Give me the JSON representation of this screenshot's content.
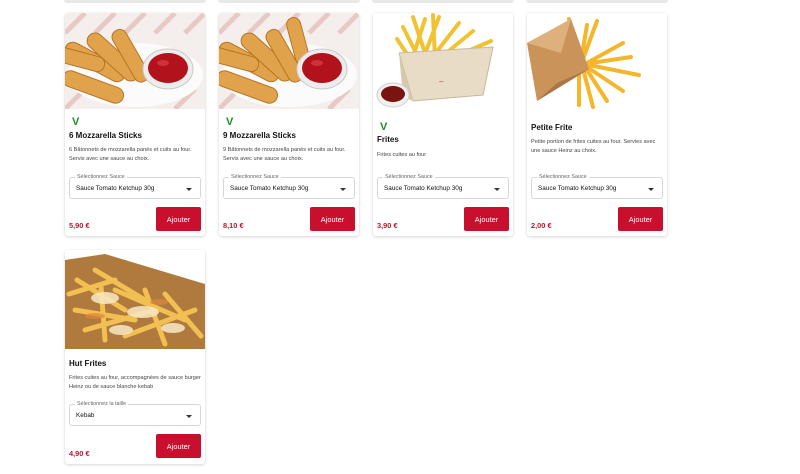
{
  "products": [
    {
      "veg_mark": "V",
      "name": "6 Mozzarella Sticks",
      "description": "6 Bâtonnets de mozzarella panés et cuits au four. Servis avec une sauce au choix.",
      "select_label": "Sélectionnez Sauce",
      "select_value": "Sauce Tomato Ketchup 30g",
      "price": "5,90 €",
      "button_label": "Ajouter"
    },
    {
      "veg_mark": "V",
      "name": "9 Mozzarella Sticks",
      "description": "9 Bâtonnets de mozzarella panés et cuits au four. Servis avec une sauce au choix.",
      "select_label": "Sélectionnez Sauce",
      "select_value": "Sauce Tomato Ketchup 30g",
      "price": "8,10 €",
      "button_label": "Ajouter"
    },
    {
      "veg_mark": "V",
      "name": "Frites",
      "description": "Frites cuites au four",
      "select_label": "Sélectionnez Sauce",
      "select_value": "Sauce Tomato Ketchup 30g",
      "price": "3,90 €",
      "button_label": "Ajouter"
    },
    {
      "name": "Petite Frite",
      "description": "Petite portion de frites cuites au four. Servies avec une sauce Heinz au choix.",
      "select_label": "Sélectionnez Sauce",
      "select_value": "Sauce Tomato Ketchup 30g",
      "price": "2,00 €",
      "button_label": "Ajouter"
    },
    {
      "name": "Hut Frites",
      "description": "Frites cuites au four, accompagnées de sauce burger Heinz ou de sauce blanche kebab",
      "select_label": "Sélectionnez la taille",
      "select_value": "Kebab",
      "price": "4,90 €",
      "button_label": "Ajouter"
    }
  ],
  "colors": {
    "accent": "#c8102e",
    "veg_green": "#1f8a2b"
  }
}
